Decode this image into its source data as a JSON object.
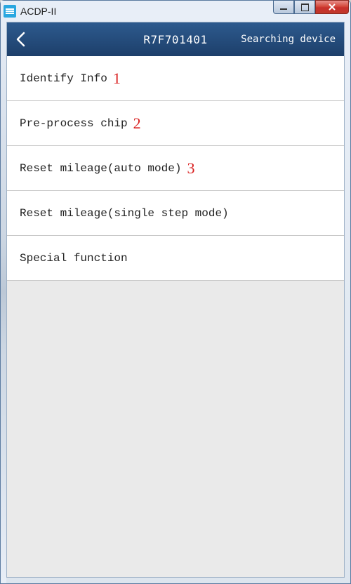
{
  "window": {
    "title": "ACDP-II"
  },
  "header": {
    "title": "R7F701401",
    "status": "Searching device"
  },
  "menu": {
    "items": [
      {
        "label": "Identify Info",
        "annotation": "1"
      },
      {
        "label": "Pre-process chip",
        "annotation": "2"
      },
      {
        "label": "Reset mileage(auto mode)",
        "annotation": "3"
      },
      {
        "label": "Reset mileage(single step mode)",
        "annotation": ""
      },
      {
        "label": "Special function",
        "annotation": ""
      }
    ]
  }
}
